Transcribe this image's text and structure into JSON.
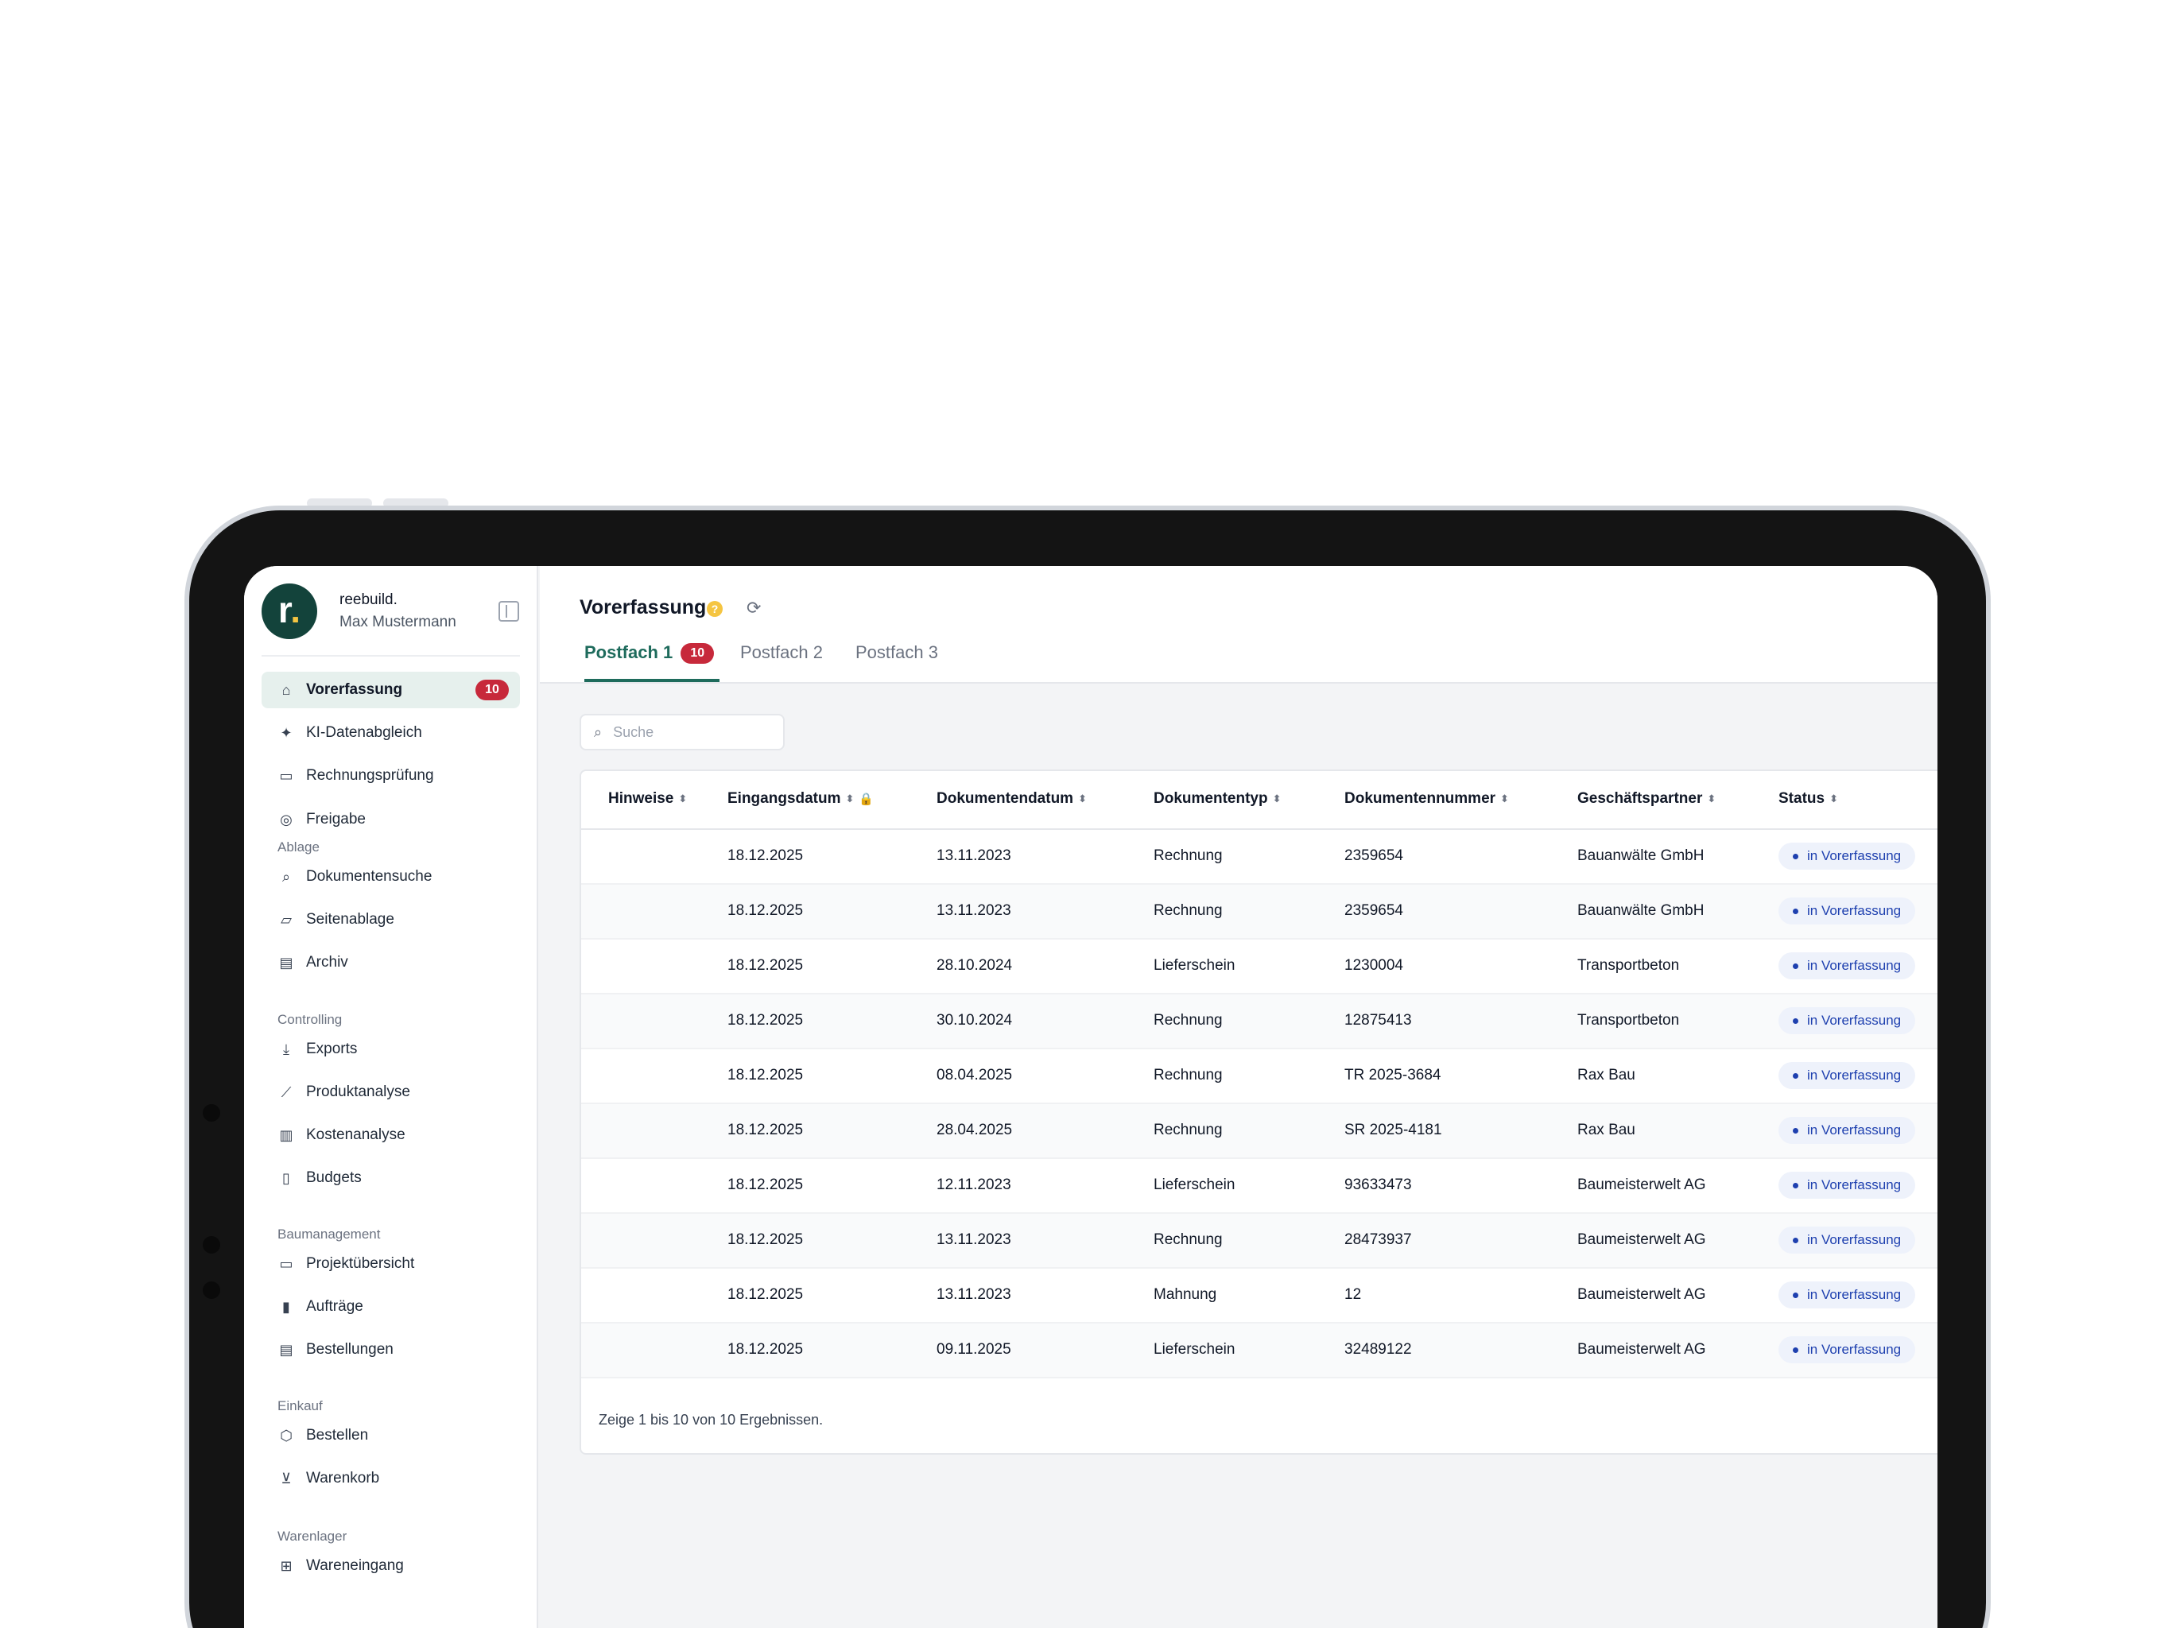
{
  "sidebar": {
    "brand_name": "reebuild.",
    "user_name": "Max Mustermann",
    "logo_letter": "r",
    "logo_dot": ".",
    "items": [
      {
        "key": "vorerfassung",
        "label": "Vorerfassung",
        "icon": "inbox-icon",
        "badge": "10",
        "active": true
      },
      {
        "key": "ki-datenabgleich",
        "label": "KI-Datenabgleich",
        "icon": "sparkles-icon"
      },
      {
        "key": "rechnungspruefung",
        "label": "Rechnungsprüfung",
        "icon": "money-icon"
      },
      {
        "key": "freigabe",
        "label": "Freigabe",
        "icon": "check-circle-icon"
      }
    ],
    "sections": [
      {
        "label": "Ablage",
        "items": [
          {
            "key": "dokumentensuche",
            "label": "Dokumentensuche",
            "icon": "search-icon"
          },
          {
            "key": "seitenablage",
            "label": "Seitenablage",
            "icon": "folder-icon"
          },
          {
            "key": "archiv",
            "label": "Archiv",
            "icon": "archive-icon"
          }
        ]
      },
      {
        "label": "Controlling",
        "items": [
          {
            "key": "exports",
            "label": "Exports",
            "icon": "download-icon"
          },
          {
            "key": "produktanalyse",
            "label": "Produktanalyse",
            "icon": "line-chart-icon"
          },
          {
            "key": "kostenanalyse",
            "label": "Kostenanalyse",
            "icon": "bar-chart-icon"
          },
          {
            "key": "budgets",
            "label": "Budgets",
            "icon": "budget-icon"
          }
        ]
      },
      {
        "label": "Baumanagement",
        "items": [
          {
            "key": "projektuebersicht",
            "label": "Projektübersicht",
            "icon": "browser-icon"
          },
          {
            "key": "auftraege",
            "label": "Aufträge",
            "icon": "notebook-icon"
          },
          {
            "key": "bestellungen",
            "label": "Bestellungen",
            "icon": "clipboard-icon"
          }
        ]
      },
      {
        "label": "Einkauf",
        "items": [
          {
            "key": "bestellen",
            "label": "Bestellen",
            "icon": "package-icon"
          },
          {
            "key": "warenkorb",
            "label": "Warenkorb",
            "icon": "cart-icon"
          }
        ]
      },
      {
        "label": "Warenlager",
        "items": [
          {
            "key": "wareneingang",
            "label": "Wareneingang",
            "icon": "box-in-icon"
          }
        ]
      }
    ]
  },
  "header": {
    "title": "Vorerfassung",
    "help": "?",
    "tabs": [
      {
        "label": "Postfach 1",
        "badge": "10",
        "active": true
      },
      {
        "label": "Postfach 2"
      },
      {
        "label": "Postfach 3"
      }
    ]
  },
  "search": {
    "placeholder": "Suche",
    "value": ""
  },
  "table": {
    "columns": [
      "Hinweise",
      "Eingangsdatum",
      "Dokumentendatum",
      "Dokumententyp",
      "Dokumentennummer",
      "Geschäftspartner",
      "Status"
    ],
    "rows": [
      {
        "hinweise": "",
        "eingang": "18.12.2025",
        "datum": "13.11.2023",
        "typ": "Rechnung",
        "nummer": "2359654",
        "partner": "Bauanwälte GmbH",
        "status": "in Vorerfassung"
      },
      {
        "hinweise": "",
        "eingang": "18.12.2025",
        "datum": "13.11.2023",
        "typ": "Rechnung",
        "nummer": "2359654",
        "partner": "Bauanwälte GmbH",
        "status": "in Vorerfassung"
      },
      {
        "hinweise": "",
        "eingang": "18.12.2025",
        "datum": "28.10.2024",
        "typ": "Lieferschein",
        "nummer": "1230004",
        "partner": "Transportbeton",
        "status": "in Vorerfassung"
      },
      {
        "hinweise": "",
        "eingang": "18.12.2025",
        "datum": "30.10.2024",
        "typ": "Rechnung",
        "nummer": "12875413",
        "partner": "Transportbeton",
        "status": "in Vorerfassung"
      },
      {
        "hinweise": "",
        "eingang": "18.12.2025",
        "datum": "08.04.2025",
        "typ": "Rechnung",
        "nummer": "TR 2025-3684",
        "partner": "Rax Bau",
        "status": "in Vorerfassung"
      },
      {
        "hinweise": "",
        "eingang": "18.12.2025",
        "datum": "28.04.2025",
        "typ": "Rechnung",
        "nummer": "SR 2025-4181",
        "partner": "Rax Bau",
        "status": "in Vorerfassung"
      },
      {
        "hinweise": "",
        "eingang": "18.12.2025",
        "datum": "12.11.2023",
        "typ": "Lieferschein",
        "nummer": "93633473",
        "partner": "Baumeisterwelt AG",
        "status": "in Vorerfassung"
      },
      {
        "hinweise": "",
        "eingang": "18.12.2025",
        "datum": "13.11.2023",
        "typ": "Rechnung",
        "nummer": "28473937",
        "partner": "Baumeisterwelt AG",
        "status": "in Vorerfassung"
      },
      {
        "hinweise": "",
        "eingang": "18.12.2025",
        "datum": "13.11.2023",
        "typ": "Mahnung",
        "nummer": "12",
        "partner": "Baumeisterwelt AG",
        "status": "in Vorerfassung"
      },
      {
        "hinweise": "",
        "eingang": "18.12.2025",
        "datum": "09.11.2025",
        "typ": "Lieferschein",
        "nummer": "32489122",
        "partner": "Baumeisterwelt AG",
        "status": "in Vorerfassung"
      }
    ],
    "footer": "Zeige 1 bis 10 von 10 Ergebnissen."
  },
  "colors": {
    "brand": "#13433b",
    "accent": "#1e6b5c",
    "badge": "#c7293b",
    "status": "#1e40af",
    "logo_dot": "#f5c542"
  }
}
